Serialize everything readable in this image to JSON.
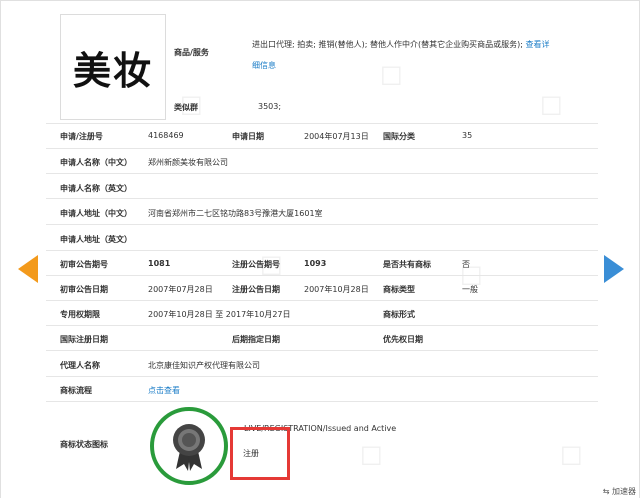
{
  "logo": {
    "text": "美妆"
  },
  "goods_services": {
    "label": "商品/服务",
    "value": "进出口代理; 拍卖; 推销(替他人); 替他人作中介(替其它企业购买商品或服务);",
    "link": "查看详",
    "link2": "细信息"
  },
  "similar_group": {
    "label": "类似群",
    "value": "3503;"
  },
  "fields": {
    "reg_no_label": "申请/注册号",
    "reg_no": "4168469",
    "apply_date_label": "申请日期",
    "apply_date": "2004年07月13日",
    "intl_class_label": "国际分类",
    "intl_class": "35",
    "applicant_cn_label": "申请人名称（中文）",
    "applicant_cn": "郑州新颜美妆有限公司",
    "applicant_en_label": "申请人名称（英文）",
    "address_cn_label": "申请人地址（中文）",
    "address_cn": "河南省郑州市二七区铭功路83号豫港大厦1601室",
    "address_en_label": "申请人地址（英文）",
    "prelim_no_label": "初审公告期号",
    "prelim_no": "1081",
    "reg_announce_no_label": "注册公告期号",
    "reg_announce_no": "1093",
    "shared_label": "是否共有商标",
    "shared": "否",
    "prelim_date_label": "初审公告日期",
    "prelim_date": "2007年07月28日",
    "reg_announce_date_label": "注册公告日期",
    "reg_announce_date": "2007年10月28日",
    "tm_type_label": "商标类型",
    "tm_type": "一般",
    "exclusive_label": "专用权期限",
    "exclusive": "2007年10月28日 至 2017年10月27日",
    "tm_form_label": "商标形式",
    "intl_reg_date_label": "国际注册日期",
    "later_date_label": "后期指定日期",
    "priority_label": "优先权日期",
    "agent_label": "代理人名称",
    "agent": "北京康佳知识产权代理有限公司",
    "process_label": "商标流程",
    "process_link": "点击查看",
    "status_label": "商标状态图标",
    "status_en": "LIVE/REGISTRATION/Issued and Active",
    "status_cn": "注册"
  },
  "footer": {
    "badge": "加速器"
  },
  "colors": {
    "arrow_left": "#f39a1c",
    "arrow_right": "#3a8ed6",
    "seal_ring": "#2a9b3b",
    "highlight_box": "#e53935",
    "link": "#1a7cc7"
  },
  "icons": [
    "prev-arrow-icon",
    "next-arrow-icon",
    "registered-seal-icon",
    "accelerator-icon"
  ]
}
